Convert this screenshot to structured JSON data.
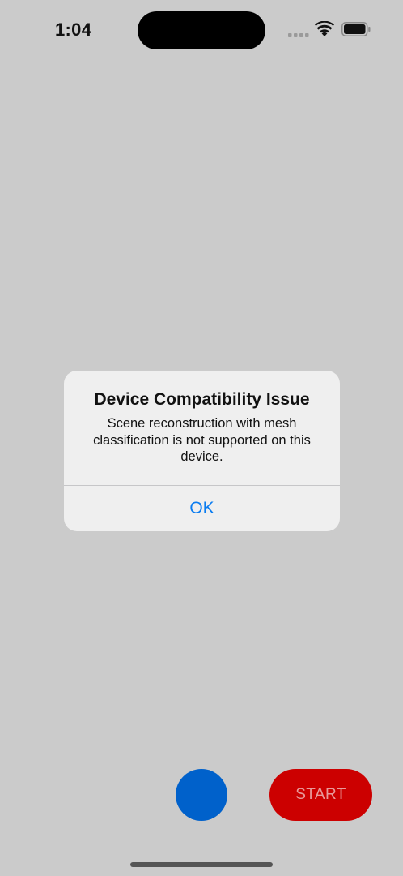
{
  "status_bar": {
    "time": "1:04",
    "icons": [
      "cellular-signal-icon",
      "wifi-icon",
      "battery-icon"
    ]
  },
  "alert": {
    "title": "Device Compatibility Issue",
    "message": "Scene reconstruction with mesh classification is not supported on this device.",
    "ok_label": "OK"
  },
  "controls": {
    "record_button_color": "#0061cb",
    "start_label": "START",
    "start_color": "#cc0000"
  },
  "colors": {
    "background": "#cbcbcb",
    "alert_background": "#efefef",
    "link_blue": "#0a7cf0"
  }
}
